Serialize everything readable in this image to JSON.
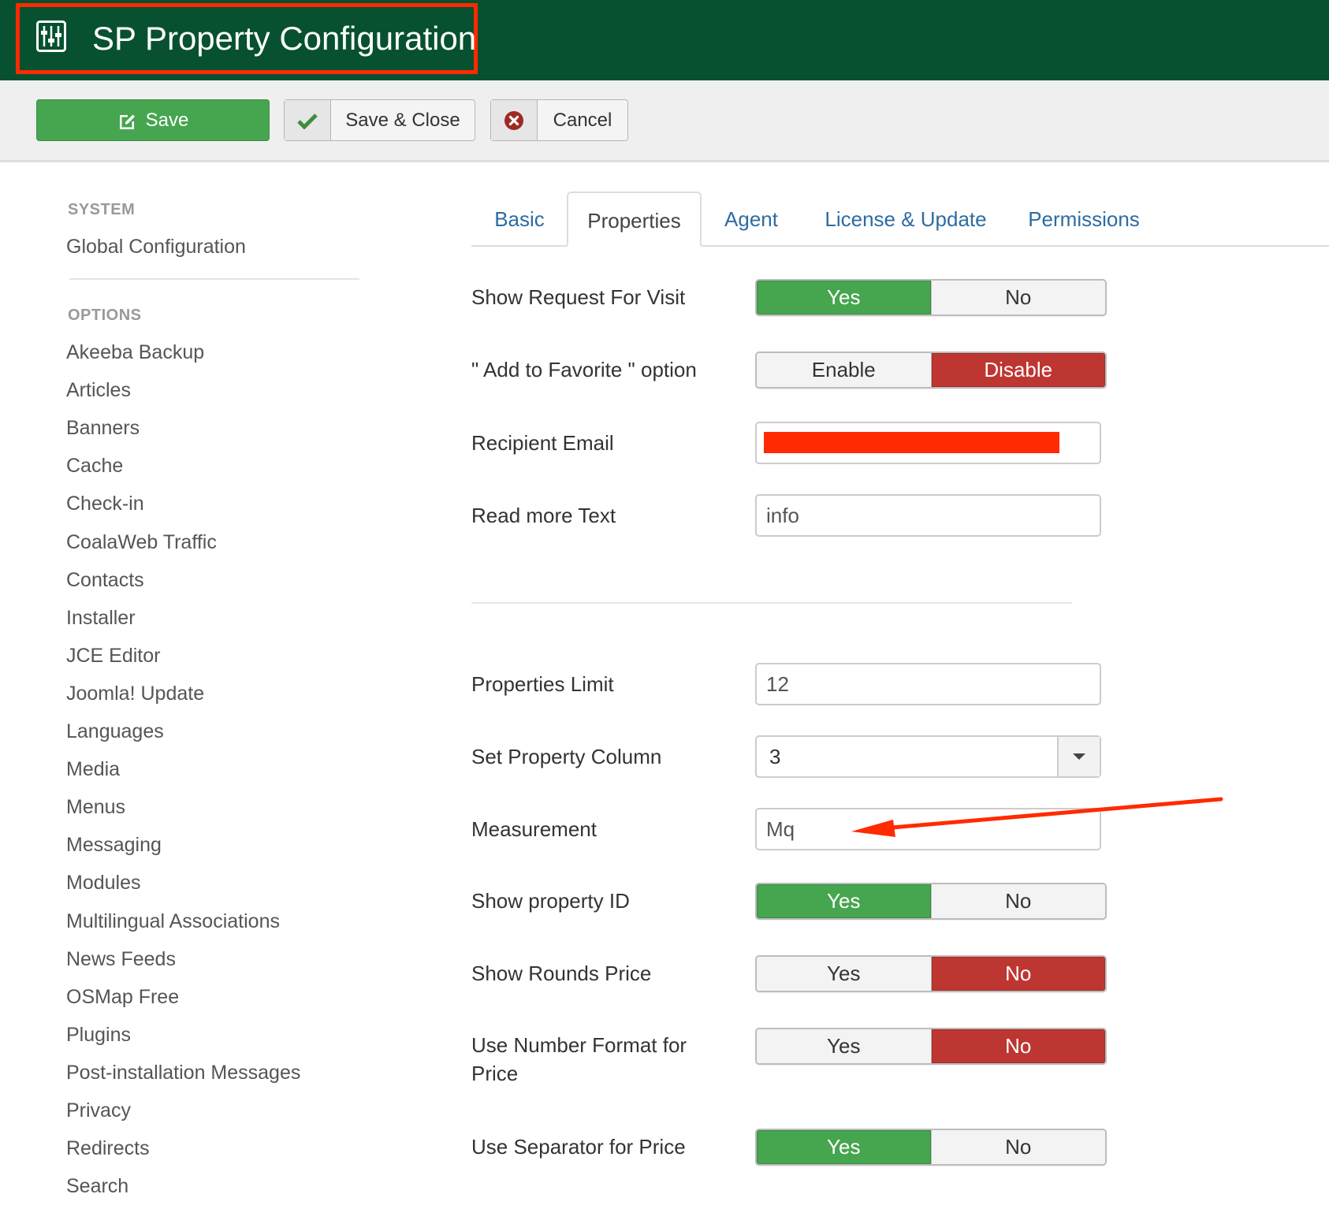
{
  "header": {
    "title": "SP Property Configuration",
    "icon": "sliders-icon",
    "background_color": "#075130",
    "highlight_color": "#ff2a00"
  },
  "toolbar": {
    "save_label": "Save",
    "save_icon": "edit-icon",
    "save_close_label": "Save & Close",
    "save_close_icon": "check-icon",
    "cancel_label": "Cancel",
    "cancel_icon": "cancel-circle-icon"
  },
  "sidebar": {
    "system_heading": "SYSTEM",
    "system_items": [
      {
        "label": "Global Configuration"
      }
    ],
    "options_heading": "OPTIONS",
    "options_items": [
      {
        "label": "Akeeba Backup"
      },
      {
        "label": "Articles"
      },
      {
        "label": "Banners"
      },
      {
        "label": "Cache"
      },
      {
        "label": "Check-in"
      },
      {
        "label": "CoalaWeb Traffic"
      },
      {
        "label": "Contacts"
      },
      {
        "label": "Installer"
      },
      {
        "label": "JCE Editor"
      },
      {
        "label": "Joomla! Update"
      },
      {
        "label": "Languages"
      },
      {
        "label": "Media"
      },
      {
        "label": "Menus"
      },
      {
        "label": "Messaging"
      },
      {
        "label": "Modules"
      },
      {
        "label": "Multilingual Associations"
      },
      {
        "label": "News Feeds"
      },
      {
        "label": "OSMap Free"
      },
      {
        "label": "Plugins"
      },
      {
        "label": "Post-installation Messages"
      },
      {
        "label": "Privacy"
      },
      {
        "label": "Redirects"
      },
      {
        "label": "Search"
      }
    ]
  },
  "tabs": [
    {
      "label": "Basic",
      "active": false
    },
    {
      "label": "Properties",
      "active": true
    },
    {
      "label": "Agent",
      "active": false
    },
    {
      "label": "License & Update",
      "active": false
    },
    {
      "label": "Permissions",
      "active": false
    }
  ],
  "form": {
    "show_request_for_visit": {
      "label": "Show Request For Visit",
      "options": [
        "Yes",
        "No"
      ],
      "selected": "Yes"
    },
    "add_to_favorite": {
      "label": "\" Add to Favorite \" option",
      "options": [
        "Enable",
        "Disable"
      ],
      "selected": "Disable"
    },
    "recipient_email": {
      "label": "Recipient Email",
      "value": "[redacted]"
    },
    "read_more_text": {
      "label": "Read more Text",
      "value": "info"
    },
    "properties_limit": {
      "label": "Properties Limit",
      "value": "12"
    },
    "set_property_column": {
      "label": "Set Property Column",
      "value": "3"
    },
    "measurement": {
      "label": "Measurement",
      "value": "Mq"
    },
    "show_property_id": {
      "label": "Show property ID",
      "options": [
        "Yes",
        "No"
      ],
      "selected": "Yes"
    },
    "show_rounds_price": {
      "label": "Show Rounds Price",
      "options": [
        "Yes",
        "No"
      ],
      "selected": "No"
    },
    "use_number_format": {
      "label": "Use Number Format for Price",
      "options": [
        "Yes",
        "No"
      ],
      "selected": "No"
    },
    "use_separator": {
      "label": "Use Separator for Price",
      "options": [
        "Yes",
        "No"
      ],
      "selected": "Yes"
    }
  },
  "colors": {
    "accent_green": "#46a54f",
    "accent_red": "#bd3631",
    "link_blue": "#2d6ca2",
    "annotation_red": "#ff2a00"
  }
}
